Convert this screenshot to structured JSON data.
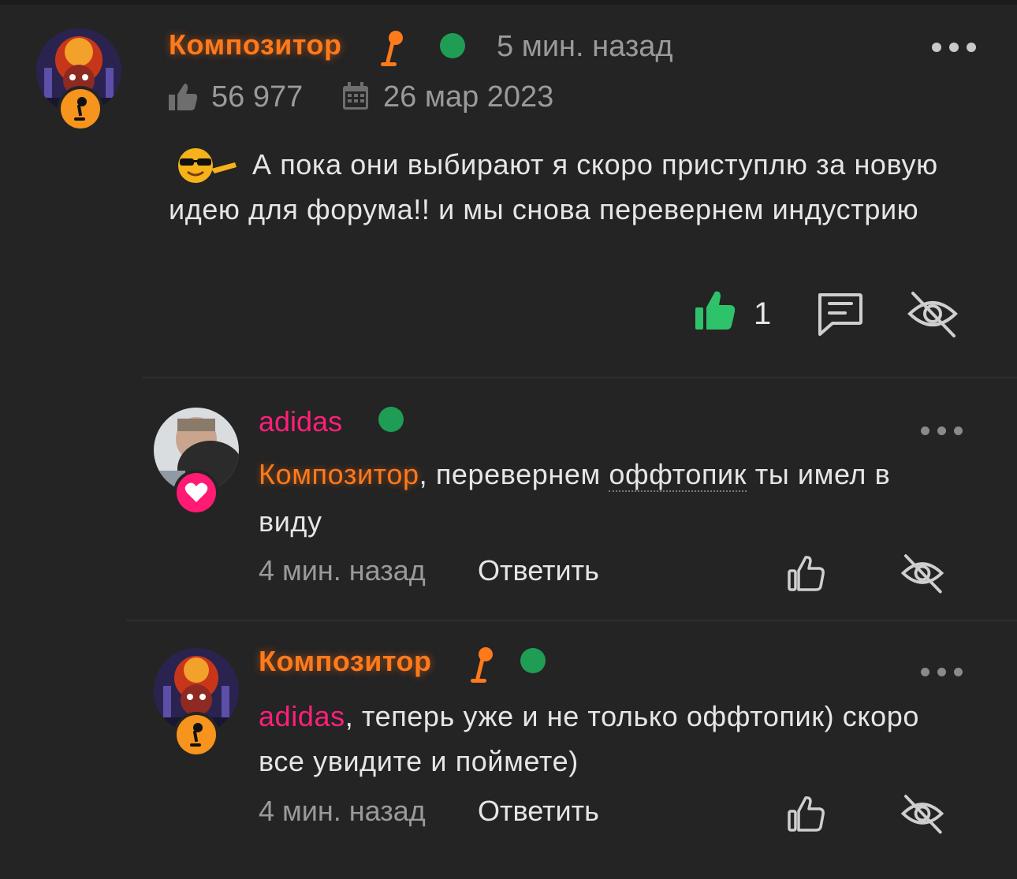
{
  "comment": {
    "author": "Композитор",
    "time": "5 мин. назад",
    "reputation": "56 977",
    "registered": "26 мар 2023",
    "text": "А пока они выбирают я скоро приступлю за новую идею для форума!! и мы снова перевернем индустрию",
    "likes": "1"
  },
  "replies": [
    {
      "author": "adidas",
      "mention": "Композитор",
      "text_before": ", перевернем ",
      "highlight": "оффтопик",
      "text_after": " ты имел в виду",
      "time": "4 мин. назад",
      "reply_label": "Ответить"
    },
    {
      "author": "Композитор",
      "mention": "adidas",
      "text": ", теперь уже и не только оффтопик) скоро все увидите и поймете)",
      "time": "4 мин. назад",
      "reply_label": "Ответить"
    }
  ],
  "colors": {
    "background": "#242424",
    "accent_orange": "#ff7a1a",
    "accent_pink": "#ff1f7a",
    "online_green": "#1f9d55",
    "like_green": "#2ec36a"
  },
  "icons": [
    "microphone-icon",
    "thumbs-up-icon",
    "calendar-icon",
    "comment-icon",
    "eye-off-icon",
    "more-icon",
    "heart-icon",
    "emoji-icon"
  ]
}
